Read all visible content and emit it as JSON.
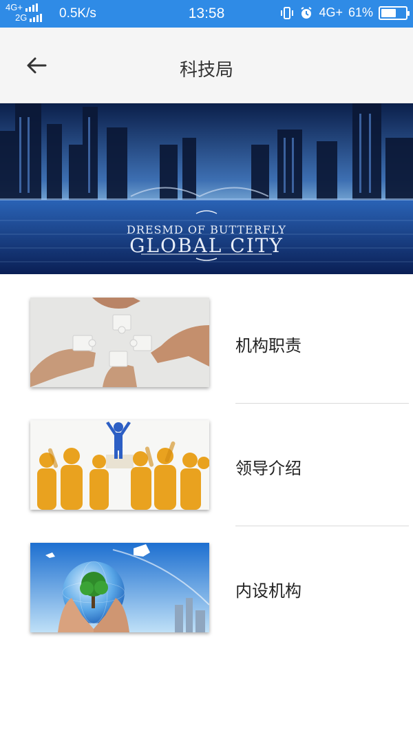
{
  "status_bar": {
    "network_top": "4G+",
    "network_bottom": "2G",
    "speed": "0.5K/s",
    "time": "13:58",
    "right_network": "4G+",
    "battery_percent_text": "61%",
    "battery_level": 0.61,
    "icons": [
      "vibrate-icon",
      "alarm-icon"
    ]
  },
  "app_bar": {
    "title": "科技局",
    "back_icon": "arrow-left-icon"
  },
  "banner": {
    "subtitle": "DRESMD OF BUTTERFLY",
    "title": "GLOBAL CITY"
  },
  "list": {
    "items": [
      {
        "label": "机构职责",
        "image": "puzzle-hands-image"
      },
      {
        "label": "领导介绍",
        "image": "leader-crowd-image"
      },
      {
        "label": "内设机构",
        "image": "globe-tree-hands-image"
      }
    ]
  },
  "colors": {
    "status_bar": "#2f8be6",
    "app_bar": "#f5f5f5",
    "text": "#222222",
    "divider": "#d9d9d9"
  }
}
